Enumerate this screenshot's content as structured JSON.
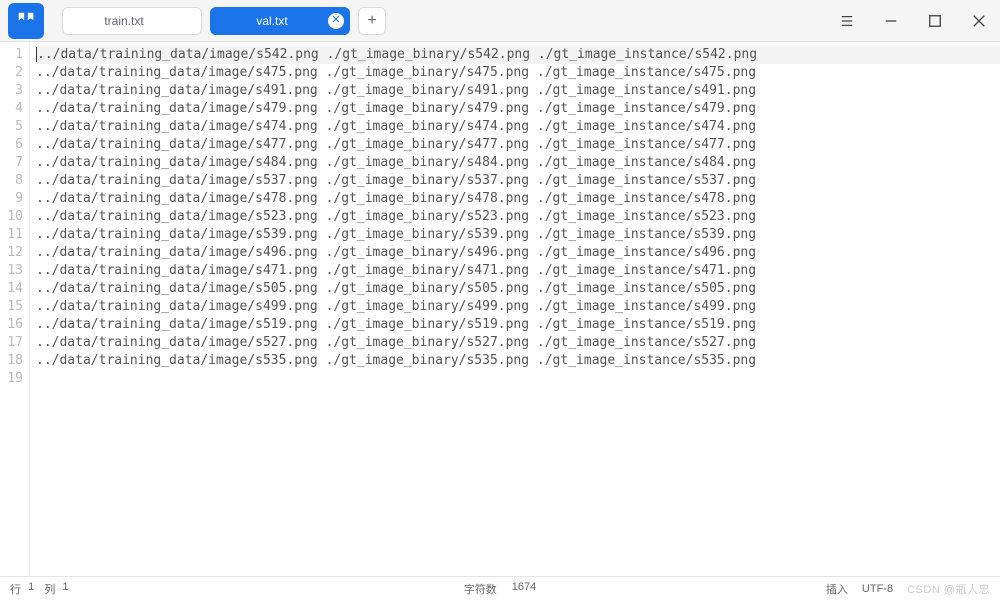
{
  "tabs": {
    "items": [
      {
        "label": "train.txt",
        "active": false
      },
      {
        "label": "val.txt",
        "active": true
      }
    ],
    "newtab_tooltip": "+"
  },
  "window": {
    "menu_icon": "≡",
    "min_icon": "—",
    "max_icon": "▢",
    "close_icon": "✕"
  },
  "file": {
    "lines": [
      "../data/training_data/image/s542.png ./gt_image_binary/s542.png ./gt_image_instance/s542.png",
      "../data/training_data/image/s475.png ./gt_image_binary/s475.png ./gt_image_instance/s475.png",
      "../data/training_data/image/s491.png ./gt_image_binary/s491.png ./gt_image_instance/s491.png",
      "../data/training_data/image/s479.png ./gt_image_binary/s479.png ./gt_image_instance/s479.png",
      "../data/training_data/image/s474.png ./gt_image_binary/s474.png ./gt_image_instance/s474.png",
      "../data/training_data/image/s477.png ./gt_image_binary/s477.png ./gt_image_instance/s477.png",
      "../data/training_data/image/s484.png ./gt_image_binary/s484.png ./gt_image_instance/s484.png",
      "../data/training_data/image/s537.png ./gt_image_binary/s537.png ./gt_image_instance/s537.png",
      "../data/training_data/image/s478.png ./gt_image_binary/s478.png ./gt_image_instance/s478.png",
      "../data/training_data/image/s523.png ./gt_image_binary/s523.png ./gt_image_instance/s523.png",
      "../data/training_data/image/s539.png ./gt_image_binary/s539.png ./gt_image_instance/s539.png",
      "../data/training_data/image/s496.png ./gt_image_binary/s496.png ./gt_image_instance/s496.png",
      "../data/training_data/image/s471.png ./gt_image_binary/s471.png ./gt_image_instance/s471.png",
      "../data/training_data/image/s505.png ./gt_image_binary/s505.png ./gt_image_instance/s505.png",
      "../data/training_data/image/s499.png ./gt_image_binary/s499.png ./gt_image_instance/s499.png",
      "../data/training_data/image/s519.png ./gt_image_binary/s519.png ./gt_image_instance/s519.png",
      "../data/training_data/image/s527.png ./gt_image_binary/s527.png ./gt_image_instance/s527.png",
      "../data/training_data/image/s535.png ./gt_image_binary/s535.png ./gt_image_instance/s535.png"
    ],
    "total_display_lines": 19
  },
  "status": {
    "row_label": "行",
    "row_val": "1",
    "col_label": "列",
    "col_val": "1",
    "char_label": "字符数",
    "char_val": "1674",
    "insert_mode": "插入",
    "encoding": "UTF-8"
  },
  "watermark": "CSDN @瓶人忠"
}
